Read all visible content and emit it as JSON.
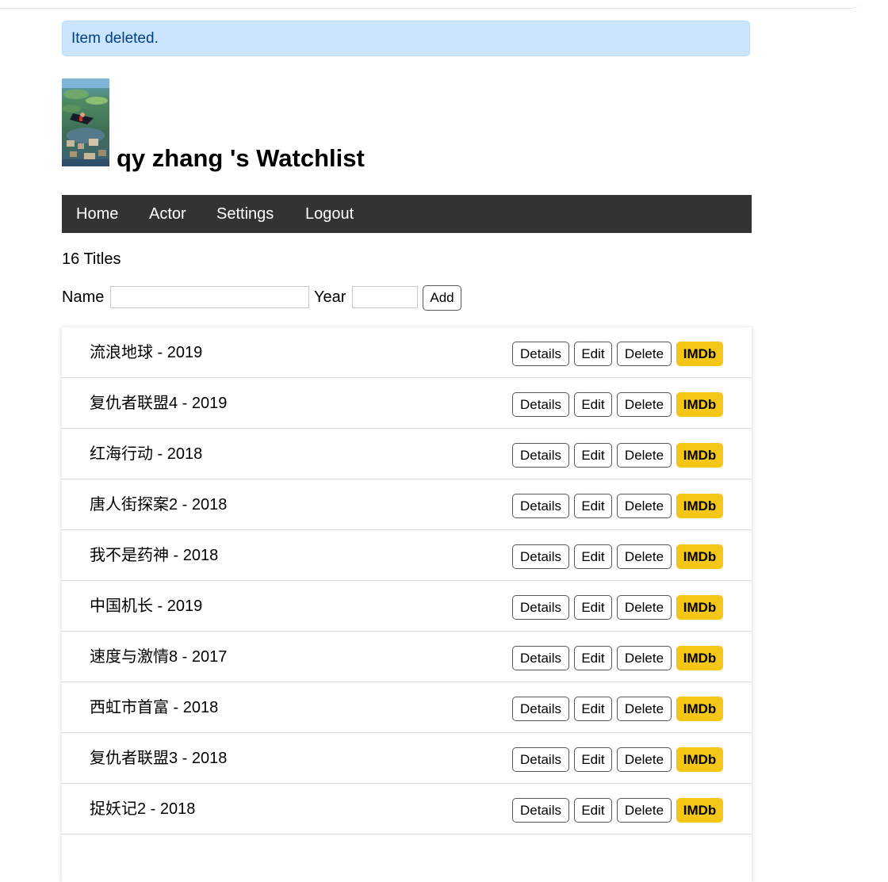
{
  "alert": {
    "message": "Item deleted."
  },
  "header": {
    "title": "qy zhang 's Watchlist"
  },
  "nav": {
    "items": [
      {
        "label": "Home"
      },
      {
        "label": "Actor"
      },
      {
        "label": "Settings"
      },
      {
        "label": "Logout"
      }
    ]
  },
  "summary": {
    "count_text": "16 Titles"
  },
  "form": {
    "name_label": "Name",
    "name_value": "",
    "year_label": "Year",
    "year_value": "",
    "add_label": "Add"
  },
  "buttons": {
    "details": "Details",
    "edit": "Edit",
    "delete": "Delete",
    "imdb": "IMDb"
  },
  "colors": {
    "alert_bg": "#cce5ff",
    "alert_text": "#004085",
    "navbar_bg": "#333333",
    "imdb_yellow": "#f5c518"
  },
  "movies": [
    {
      "title": "流浪地球 - 2019"
    },
    {
      "title": "复仇者联盟4 - 2019"
    },
    {
      "title": "红海行动 - 2018"
    },
    {
      "title": "唐人街探案2 - 2018"
    },
    {
      "title": "我不是药神 - 2018"
    },
    {
      "title": "中国机长 - 2019"
    },
    {
      "title": "速度与激情8 - 2017"
    },
    {
      "title": "西虹市首富 - 2018"
    },
    {
      "title": "复仇者联盟3 - 2018"
    },
    {
      "title": "捉妖记2 - 2018"
    }
  ]
}
